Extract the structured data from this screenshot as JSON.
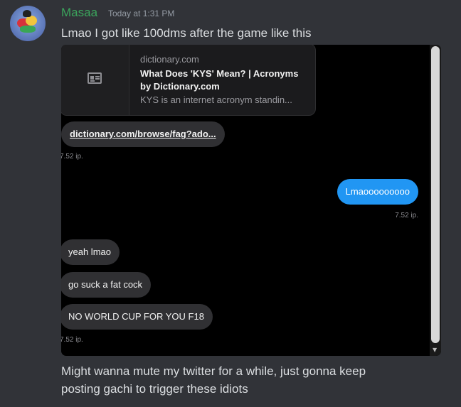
{
  "message": {
    "username": "Masaa",
    "timestamp": "Today at 1:31 PM",
    "text_top": "Lmao I got like 100dms after the game like this",
    "text_bottom_line1": "Might wanna mute my twitter for a while, just gonna keep",
    "text_bottom_line2": "posting gachi to trigger these idiots"
  },
  "screenshot": {
    "link_card": {
      "domain": "dictionary.com",
      "title_line1": "What Does 'KYS' Mean? | Acronyms",
      "title_line2": "by Dictionary.com",
      "description": "KYS is an internet acronym standin..."
    },
    "link_text": "dictionary.com/browse/fag?ado...",
    "time_1": "7.52 ip.",
    "reply_outgoing": "Lmaooooooooo",
    "time_2": "7.52 ip.",
    "msg_1": "yeah lmao",
    "msg_2": "go suck a fat cock",
    "msg_3": "NO WORLD CUP FOR YOU F18",
    "time_3": "7.52 ip."
  },
  "colors": {
    "username": "#3ba55c",
    "background": "#313338",
    "outgoing_bubble": "#2196f3",
    "incoming_bubble": "#303033"
  },
  "icons": [
    "article-icon",
    "scroll-down-arrow-icon"
  ]
}
